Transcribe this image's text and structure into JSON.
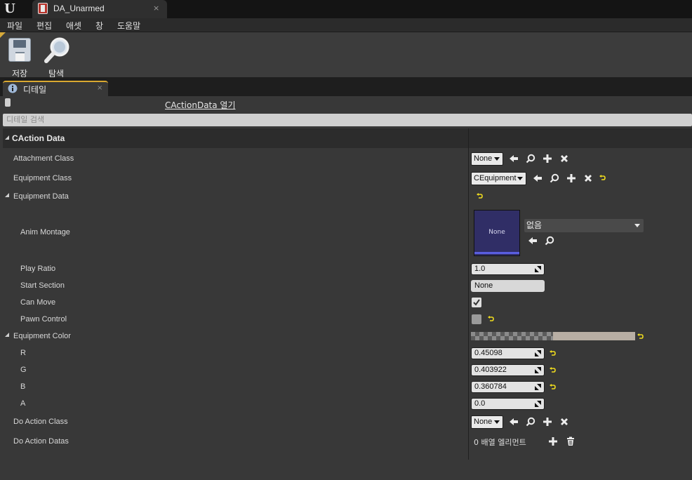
{
  "window": {
    "tab_title": "DA_Unarmed",
    "tab_close": "×"
  },
  "menu": [
    "파일",
    "편집",
    "애셋",
    "창",
    "도움말"
  ],
  "toolbar": {
    "save_label": "저장",
    "browse_label": "탐색"
  },
  "details_tab": {
    "label": "디테일",
    "close": "×"
  },
  "open_class_link": "CActionData 열기",
  "search": {
    "placeholder": "디테일 검색"
  },
  "category": {
    "label": "CAction Data"
  },
  "properties": {
    "attachment_class": {
      "label": "Attachment Class",
      "value": "None"
    },
    "equipment_class": {
      "label": "Equipment Class",
      "value": "CEquipment"
    },
    "equipment_data": {
      "label": "Equipment Data"
    },
    "anim_montage": {
      "label": "Anim Montage",
      "thumb_label": "None",
      "asset_value": "없음"
    },
    "play_ratio": {
      "label": "Play Ratio",
      "value": "1.0"
    },
    "start_section": {
      "label": "Start Section",
      "value": "None"
    },
    "can_move": {
      "label": "Can Move",
      "checked": true
    },
    "pawn_control": {
      "label": "Pawn Control",
      "checked": false
    },
    "equipment_color": {
      "label": "Equipment Color",
      "swatch": "#b8aea4"
    },
    "r": {
      "label": "R",
      "value": "0.45098"
    },
    "g": {
      "label": "G",
      "value": "0.403922"
    },
    "b": {
      "label": "B",
      "value": "0.360784"
    },
    "a": {
      "label": "A",
      "value": "0.0"
    },
    "do_action_class": {
      "label": "Do Action Class",
      "value": "None"
    },
    "do_action_datas": {
      "label": "Do Action Datas",
      "array_text": "0 배열 엘리먼트"
    }
  },
  "icons": {
    "use_selected": "arrow-left-icon",
    "browse": "search-icon",
    "new": "plus-icon",
    "clear": "x-icon",
    "reset": "reset-to-default-icon",
    "delete": "trash-icon"
  },
  "colors": {
    "accent": "#d9a830",
    "reset_arrow": "#f0dc1e",
    "thumbnail": "#302e66"
  }
}
